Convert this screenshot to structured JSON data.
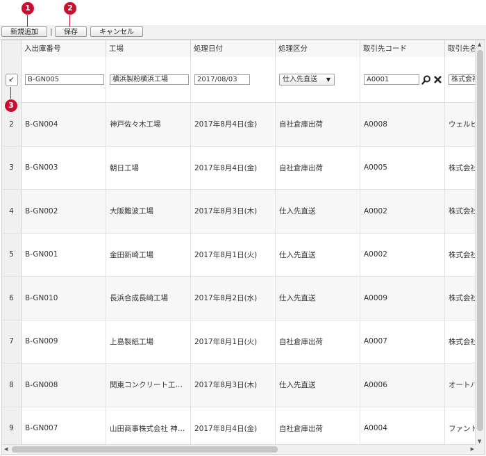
{
  "callouts": [
    "1",
    "2",
    "3"
  ],
  "toolbar": {
    "new_label": "新規追加",
    "separator": "|",
    "save_label": "保存",
    "cancel_label": "キャンセル"
  },
  "columns": [
    "入出庫番号",
    "工場",
    "処理日付",
    "処理区分",
    "取引先コード",
    "取引先名"
  ],
  "edit_row": {
    "number": "B-GN005",
    "factory": "横浜製粉横浜工場",
    "date": "2017/08/03",
    "kubun": "仕入先直送",
    "code": "A0001",
    "name": "株式会社"
  },
  "rows": [
    {
      "num": "2",
      "number": "B-GN004",
      "factory": "神戸佐々木工場",
      "date": "2017年8月4日(金)",
      "kubun": "自社倉庫出荷",
      "code": "A0008",
      "name": "ウェルビ"
    },
    {
      "num": "3",
      "number": "B-GN003",
      "factory": "朝日工場",
      "date": "2017年8月4日(金)",
      "kubun": "自社倉庫出荷",
      "code": "A0005",
      "name": "株式会社"
    },
    {
      "num": "4",
      "number": "B-GN002",
      "factory": "大阪難波工場",
      "date": "2017年8月3日(木)",
      "kubun": "仕入先直送",
      "code": "A0002",
      "name": "株式会社"
    },
    {
      "num": "5",
      "number": "B-GN001",
      "factory": "金田新崎工場",
      "date": "2017年8月1日(火)",
      "kubun": "仕入先直送",
      "code": "A0002",
      "name": "株式会社"
    },
    {
      "num": "6",
      "number": "B-GN010",
      "factory": "長浜合成長崎工場",
      "date": "2017年8月2日(水)",
      "kubun": "仕入先直送",
      "code": "A0009",
      "name": "株式会社"
    },
    {
      "num": "7",
      "number": "B-GN009",
      "factory": "上島製紙工場",
      "date": "2017年8月1日(火)",
      "kubun": "自社倉庫出荷",
      "code": "A0007",
      "name": "株式会社"
    },
    {
      "num": "8",
      "number": "B-GN008",
      "factory": "関東コンクリート工…",
      "date": "2017年8月3日(木)",
      "kubun": "仕入先直送",
      "code": "A0006",
      "name": "オートバ"
    },
    {
      "num": "9",
      "number": "B-GN007",
      "factory": "山田商事株式会社 神…",
      "date": "2017年8月4日(金)",
      "kubun": "自社倉庫出荷",
      "code": "A0004",
      "name": "ファント"
    }
  ],
  "icons": {
    "edit_indicator": "edit-row-icon",
    "search": "search-icon",
    "clear": "close-icon"
  },
  "colors": {
    "callout": "#c8102e",
    "alt_row": "#f7f7f7"
  }
}
